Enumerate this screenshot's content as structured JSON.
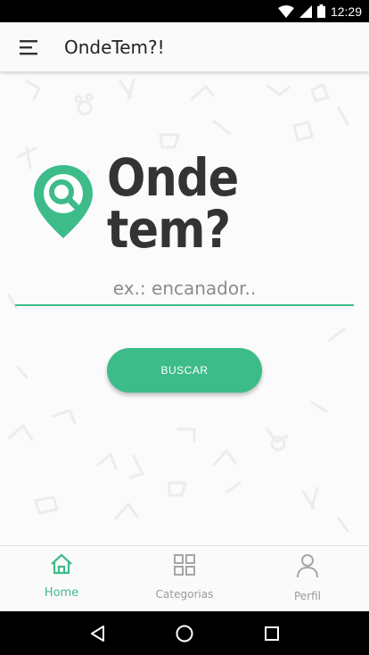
{
  "status_bar": {
    "time": "12:29",
    "icons": [
      "wifi-icon",
      "signal-icon",
      "battery-icon"
    ]
  },
  "app_bar": {
    "title": "OndeTem?!",
    "menu_icon": "hamburger-menu-icon"
  },
  "logo": {
    "text": "Onde tem?",
    "icon": "map-pin-search-icon"
  },
  "search": {
    "placeholder": "ex.: encanador..",
    "value": "",
    "button_label": "BUSCAR"
  },
  "bottom_nav": {
    "items": [
      {
        "label": "Home",
        "icon": "home-icon",
        "active": true
      },
      {
        "label": "Categorias",
        "icon": "grid-icon",
        "active": false
      },
      {
        "label": "Perfil",
        "icon": "person-icon",
        "active": false
      }
    ]
  },
  "system_nav": {
    "icons": [
      "back-icon",
      "home-circle-icon",
      "recents-icon"
    ]
  },
  "colors": {
    "accent": "#3dbc8a",
    "logo_text": "#333333",
    "background": "#fbfbfb"
  }
}
